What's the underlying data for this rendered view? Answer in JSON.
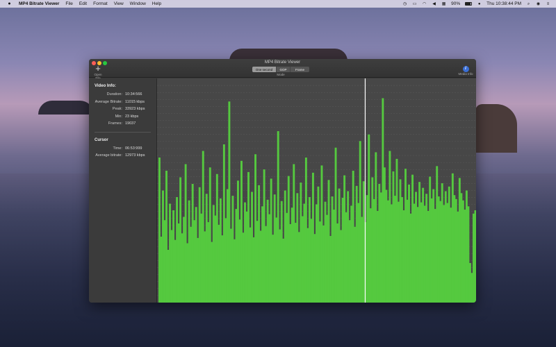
{
  "menubar": {
    "app_name": "MP4 Bitrate Viewer",
    "items": [
      "File",
      "Edit",
      "Format",
      "View",
      "Window",
      "Help"
    ],
    "battery": "90%",
    "clock": "Thu 10:38:44 PM"
  },
  "window": {
    "title": "MP4 Bitrate Viewer",
    "open_file_label": "Open File",
    "mode_label": "Mode",
    "mode_options": [
      "One second",
      "GOP",
      "Frame"
    ],
    "mode_selected": "One second",
    "media_info_label": "Media Info"
  },
  "video_info": {
    "title": "Video Info:",
    "duration_label": "Duration:",
    "duration": "10:34:566",
    "avg_label": "Average Bitrate:",
    "avg": "11015 kbps",
    "peak_label": "Peak:",
    "peak": "33923 kbps",
    "min_label": "Min:",
    "min": "23 kbps",
    "frames_label": "Frames:",
    "frames": "19037"
  },
  "cursor": {
    "title": "Cursor",
    "time_label": "Time:",
    "time": "06:53:999",
    "avg_label": "Average bitrate:",
    "avg": "12973 kbps"
  },
  "chart_data": {
    "type": "bar",
    "series_color": "#55c93f",
    "x_range": [
      0,
      634.566
    ],
    "y_range": [
      0,
      34000
    ],
    "grid": true,
    "cursor_time": 413.999,
    "values": [
      22000,
      10000,
      17000,
      12500,
      20000,
      8000,
      15000,
      11000,
      14000,
      9500,
      16000,
      12000,
      19000,
      10500,
      13000,
      21000,
      9000,
      15500,
      11500,
      18000,
      12500,
      14500,
      9800,
      17500,
      13500,
      23000,
      10800,
      16500,
      12200,
      20500,
      9200,
      14800,
      13200,
      19500,
      11800,
      15800,
      10200,
      24000,
      12800,
      17200,
      30500,
      11200,
      16200,
      9600,
      14200,
      18500,
      12600,
      21500,
      10600,
      15200,
      13800,
      19800,
      11400,
      16800,
      9900,
      22500,
      12400,
      17800,
      10900,
      14600,
      20200,
      11600,
      15600,
      13400,
      18800,
      10300,
      16400,
      12900,
      26000,
      11100,
      15400,
      9700,
      17000,
      13600,
      19200,
      11900,
      14400,
      21000,
      12100,
      16600,
      10700,
      18200,
      13100,
      15000,
      22000,
      11300,
      16000,
      12700,
      19700,
      10400,
      14900,
      17600,
      12300,
      20800,
      11700,
      15300,
      13300,
      18600,
      10100,
      16100,
      14100,
      23500,
      12000,
      17300,
      11000,
      15900,
      19300,
      13700,
      16900,
      12500,
      14700,
      20000,
      11500,
      17700,
      15100,
      24500,
      13000,
      18400,
      12200,
      16300,
      25500,
      14300,
      19000,
      15700,
      22800,
      13900,
      18000,
      16700,
      31000,
      20500,
      17100,
      15500,
      23000,
      14900,
      19900,
      16200,
      21800,
      15300,
      18700,
      16000,
      14000,
      20300,
      15600,
      17900,
      13500,
      19400,
      15000,
      16800,
      14500,
      18300,
      15200,
      17400,
      14700,
      16500,
      13900,
      19100,
      15800,
      17200,
      14200,
      20700,
      16100,
      15400,
      18100,
      14800,
      16900,
      15100,
      17600,
      14400,
      19600,
      16300,
      15700,
      13800,
      18900,
      16600,
      15500,
      14100,
      17000,
      14600,
      6000,
      4500,
      13500,
      14000
    ]
  }
}
